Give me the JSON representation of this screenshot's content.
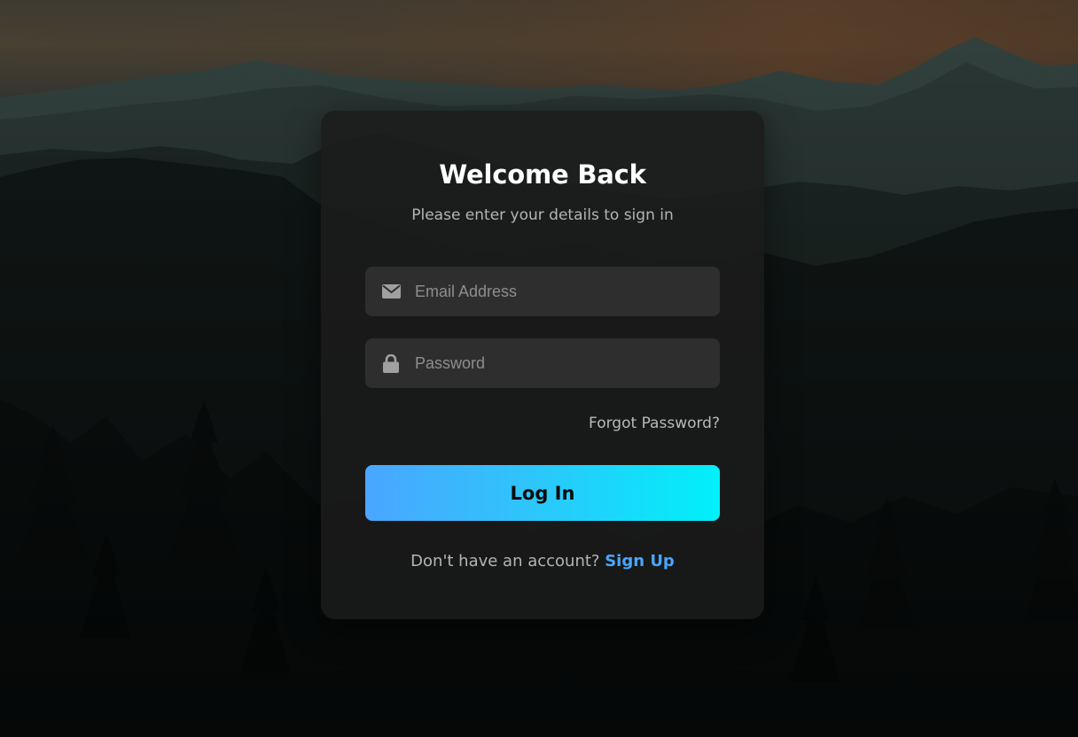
{
  "login": {
    "title": "Welcome Back",
    "subtitle": "Please enter your details to sign in",
    "email": {
      "placeholder": "Email Address",
      "value": "",
      "icon": "envelope-icon"
    },
    "password": {
      "placeholder": "Password",
      "value": "",
      "icon": "lock-icon"
    },
    "forgot_label": "Forgot Password?",
    "submit_label": "Log In",
    "signup_prompt": "Don't have an account?",
    "signup_label": "Sign Up"
  },
  "colors": {
    "accent": "#4aa6ff",
    "accent_end": "#00f0fa",
    "card_bg": "#1c1c1c",
    "field_bg": "#2e2e2e"
  }
}
